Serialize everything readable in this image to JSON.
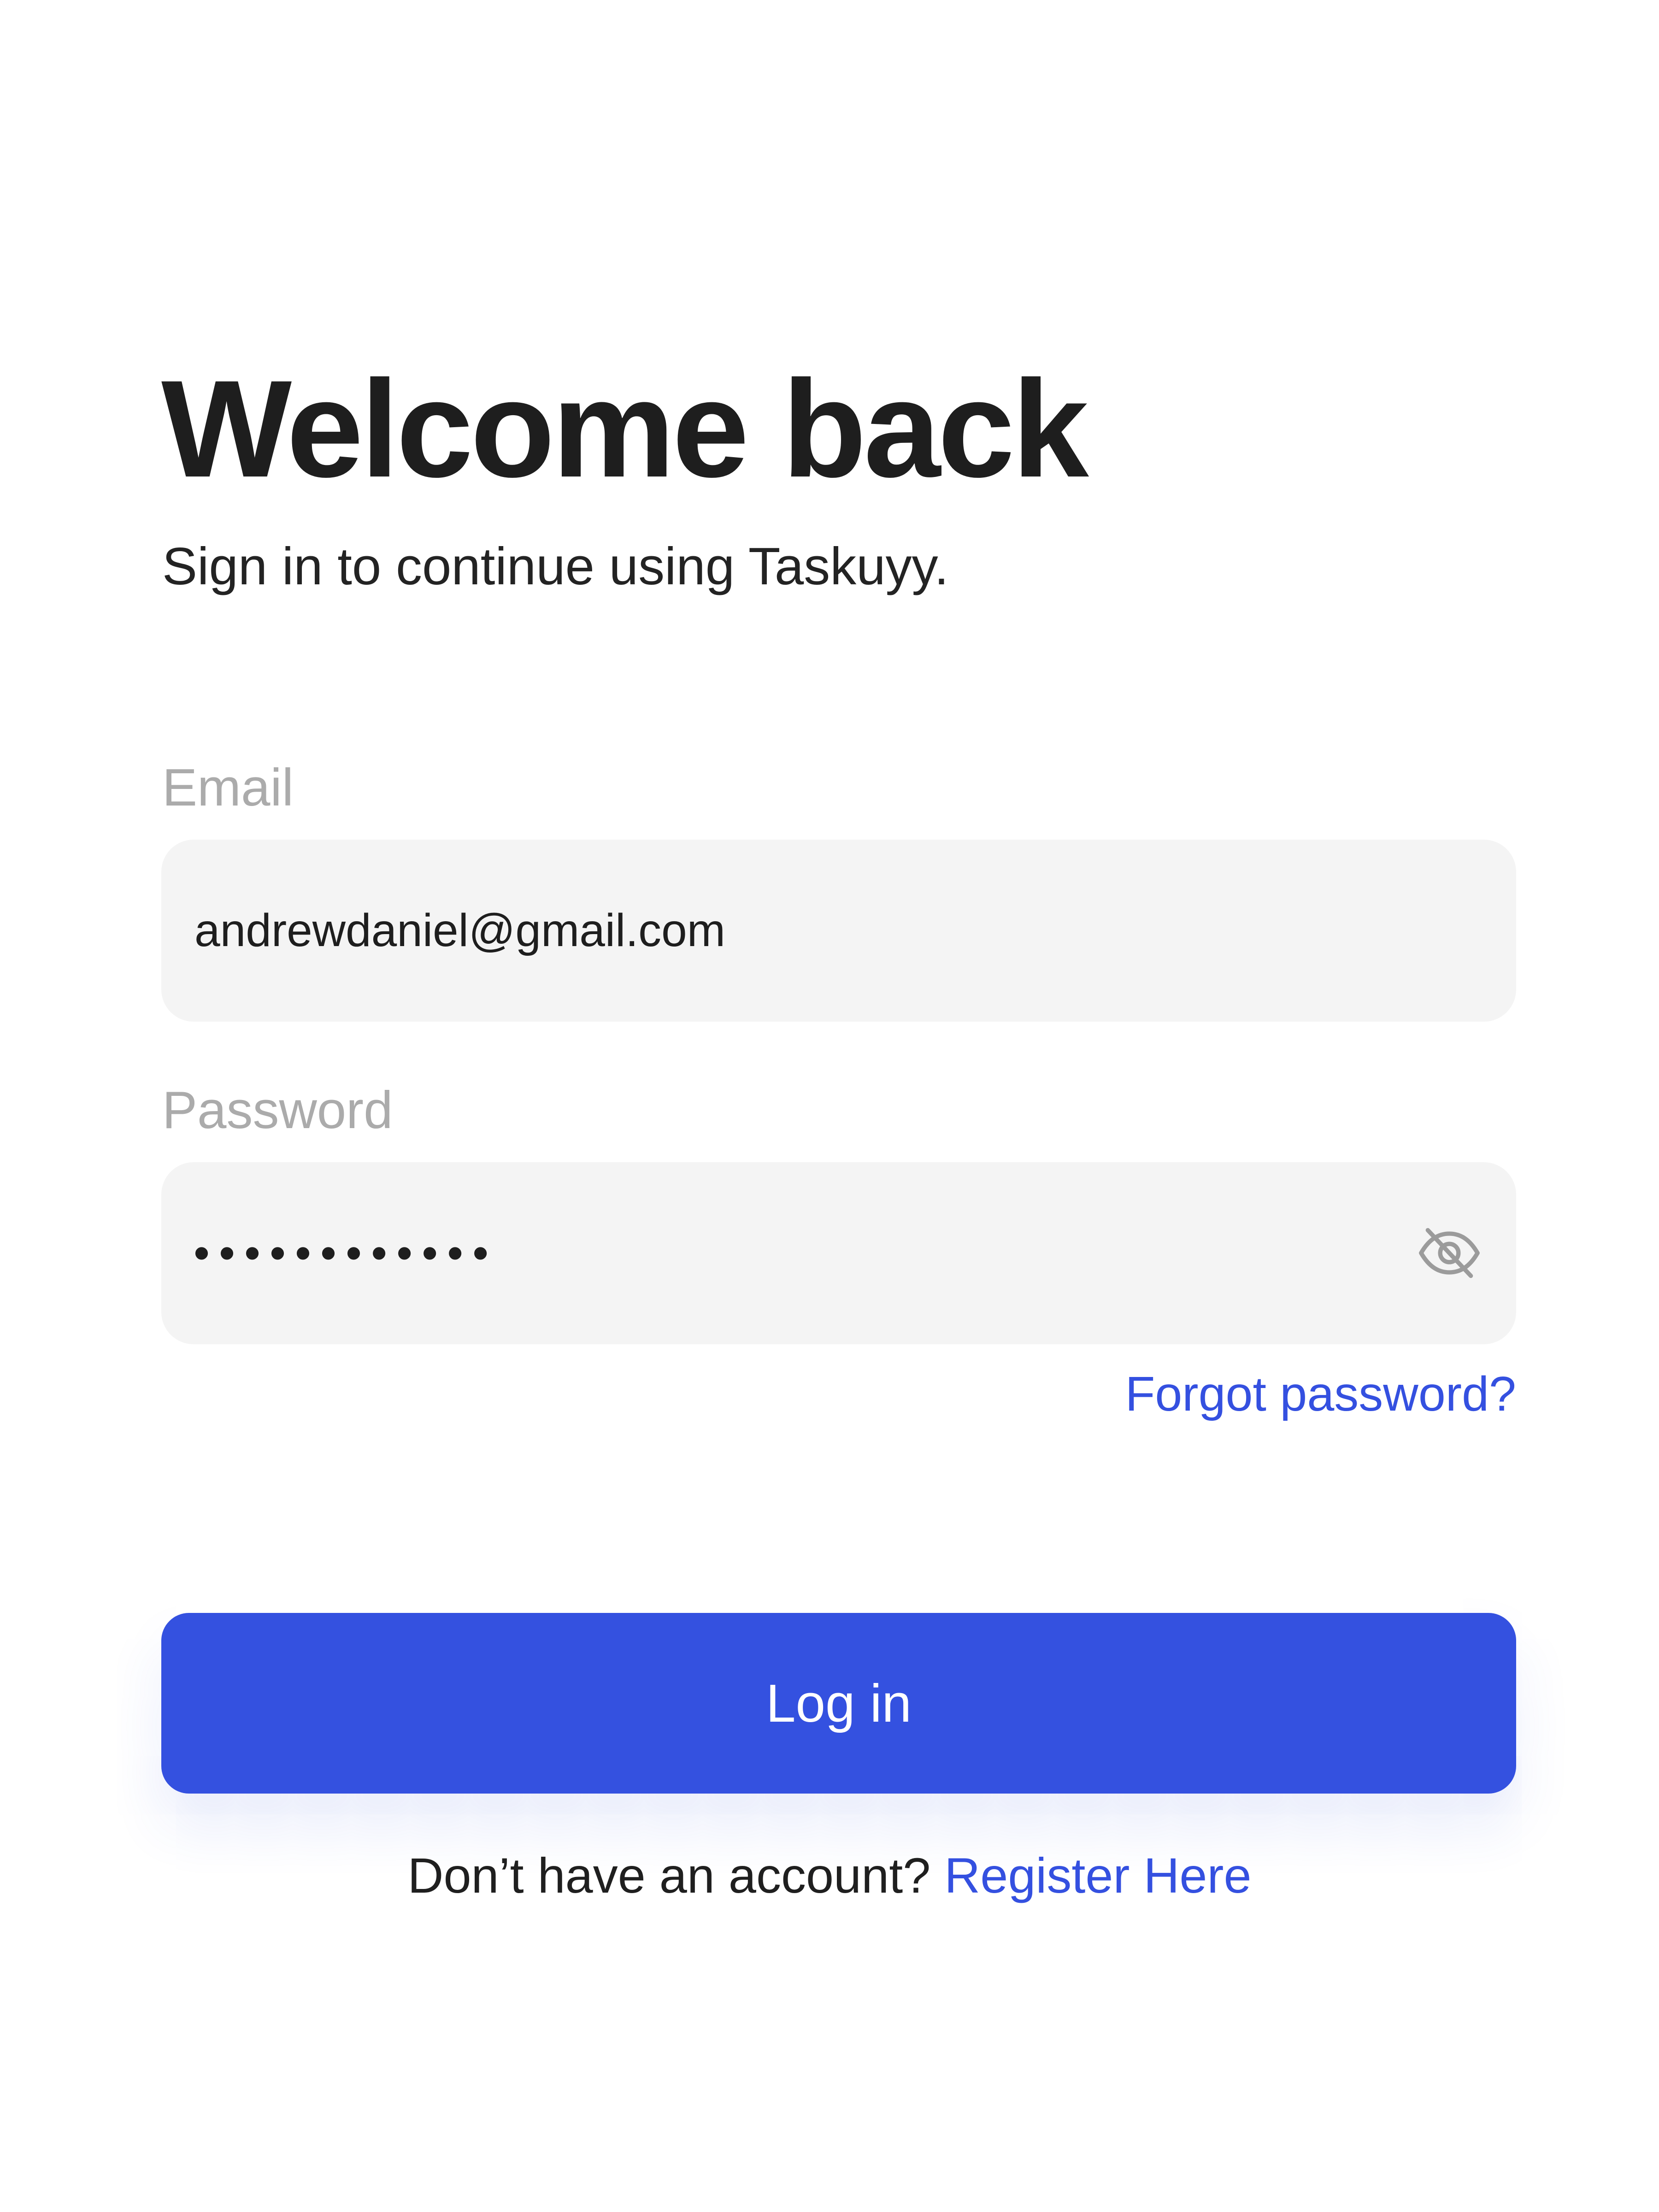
{
  "header": {
    "title": "Welcome back",
    "subtitle": "Sign in to continue using Taskuyy."
  },
  "form": {
    "email": {
      "label": "Email",
      "value": "andrewdaniel@gmail.com"
    },
    "password": {
      "label": "Password",
      "masked_value": "••••••••••••",
      "visibility_icon": "eye-off-icon"
    },
    "forgot_password_label": "Forgot password?",
    "login_label": "Log in"
  },
  "footer": {
    "prompt": "Don’t have an account?",
    "register_label": "Register Here"
  },
  "colors": {
    "accent": "#3451E0",
    "input_background": "#F4F4F4",
    "label_gray": "#ABABAB",
    "text_dark": "#1E1E1E"
  }
}
